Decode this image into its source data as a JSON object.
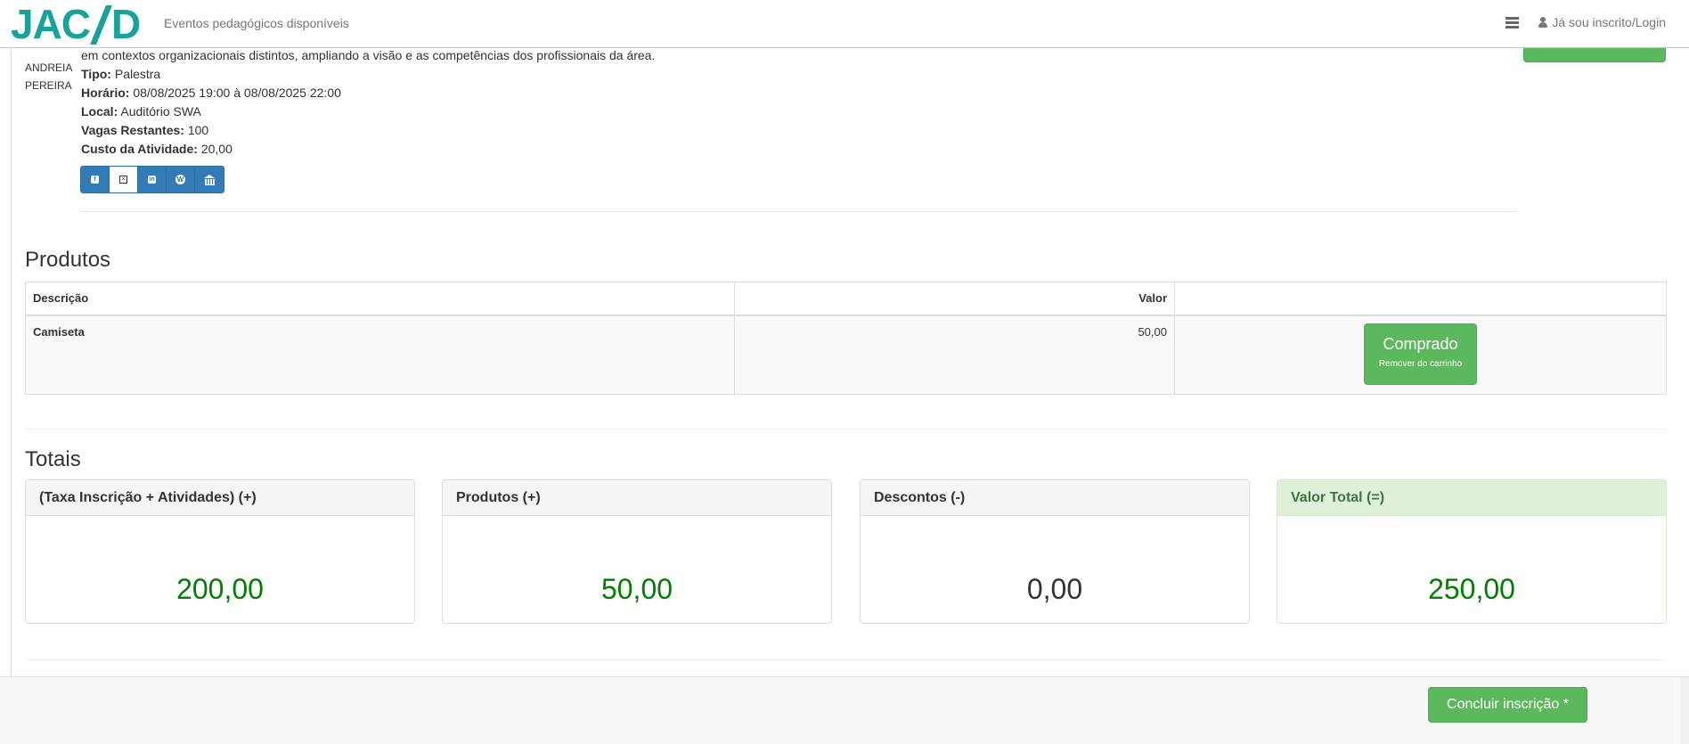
{
  "navbar": {
    "logo_left": "JAC",
    "logo_right": "D",
    "title": "Eventos pedagógicos disponíveis",
    "login_label": "Já sou inscrito/Login"
  },
  "activity": {
    "speaker_line1": "ANDREIA",
    "speaker_line2": "PEREIRA",
    "description_tail": "em contextos organizacionais distintos, ampliando a visão e as competências dos profissionais da área.",
    "tipo_label": "Tipo:",
    "tipo_value": "Palestra",
    "horario_label": "Horário:",
    "horario_value": "08/08/2025 19:00 à 08/08/2025 22:00",
    "local_label": "Local:",
    "local_value": "Auditório SWA",
    "vagas_label": "Vagas Restantes:",
    "vagas_value": "100",
    "custo_label": "Custo da Atividade:",
    "custo_value": "20,00",
    "share_icons": [
      "facebook-icon",
      "x-twitter-icon",
      "linkedin-icon",
      "wordpress-icon",
      "bank-icon"
    ]
  },
  "products": {
    "title": "Produtos",
    "headers": {
      "description": "Descrição",
      "value": "Valor",
      "action": ""
    },
    "rows": [
      {
        "description": "Camiseta",
        "value": "50,00",
        "button_main": "Comprado",
        "button_sub": "Remover do carrinho"
      }
    ]
  },
  "totals": {
    "title": "Totais",
    "panels": [
      {
        "label": "(Taxa Inscrição + Atividades) (+)",
        "value": "200,00"
      },
      {
        "label": "Produtos (+)",
        "value": "50,00"
      },
      {
        "label": "Descontos (-)",
        "value": "0,00"
      },
      {
        "label": "Valor Total (=)",
        "value": "250,00"
      }
    ]
  },
  "footer": {
    "conclude_label": "Concluir inscrição *"
  },
  "colors": {
    "brand": "#17a39a",
    "success": "#5cb85c",
    "primary": "#337ab7",
    "value_green": "#008000"
  }
}
